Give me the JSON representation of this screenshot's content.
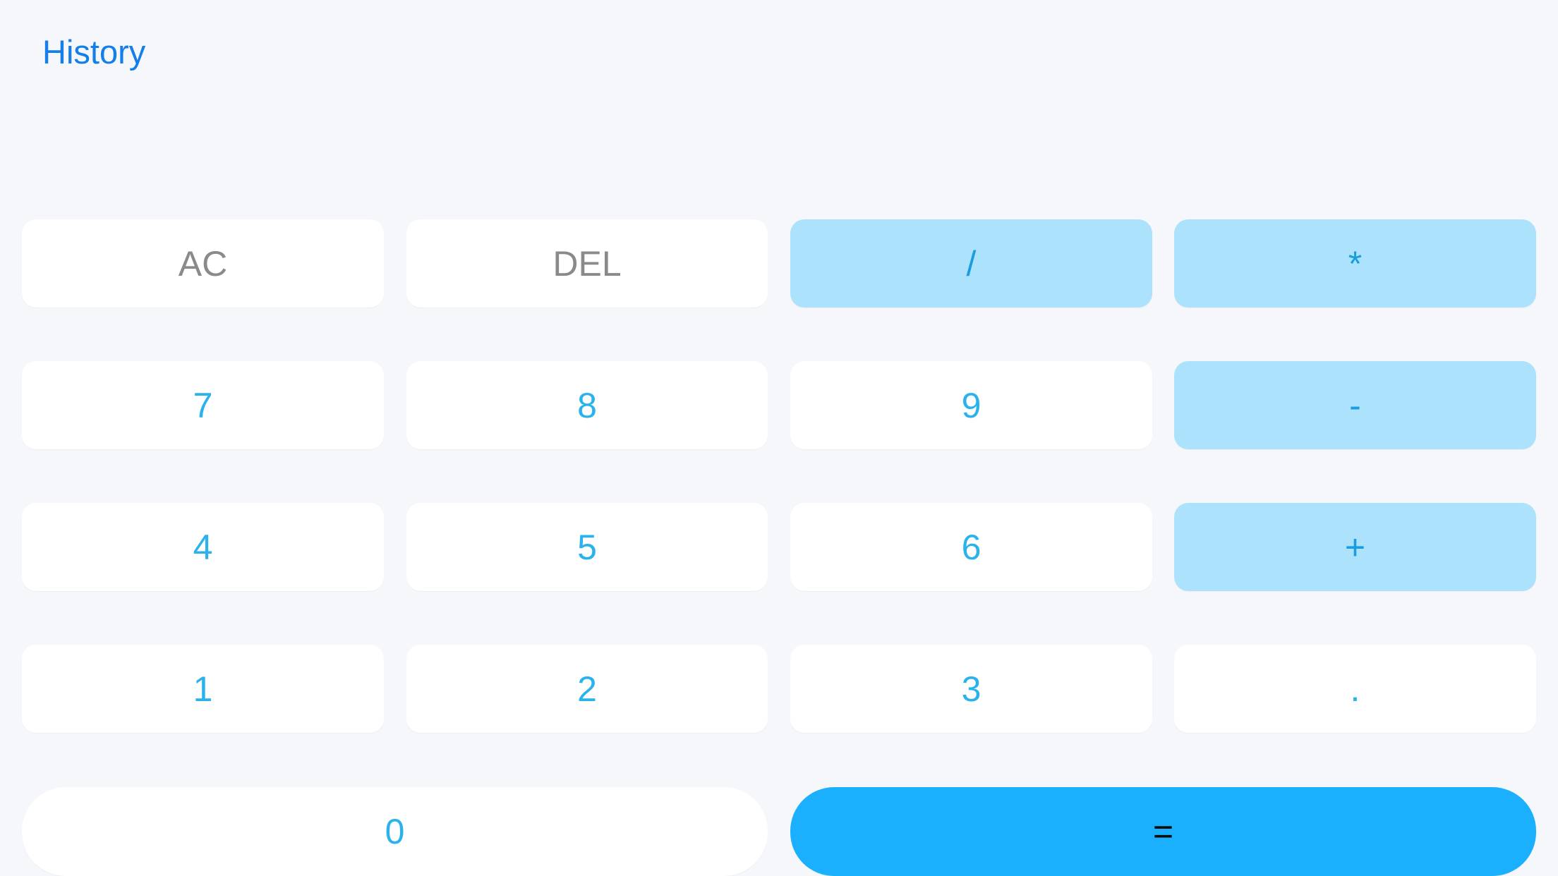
{
  "header": {
    "history_label": "History"
  },
  "display": {
    "value": ""
  },
  "keys": {
    "ac": "AC",
    "del": "DEL",
    "divide": "/",
    "multiply": "*",
    "seven": "7",
    "eight": "8",
    "nine": "9",
    "minus": "-",
    "four": "4",
    "five": "5",
    "six": "6",
    "plus": "+",
    "one": "1",
    "two": "2",
    "three": "3",
    "decimal": ".",
    "zero": "0",
    "equals": "="
  },
  "colors": {
    "background": "#f5f7fa",
    "link": "#147ee9",
    "digit_text": "#2ab2ec",
    "function_text": "#8a8a8a",
    "operator_bg": "#ade2fd",
    "operator_text": "#1a9ddf",
    "equals_bg": "#1bb0fd"
  }
}
